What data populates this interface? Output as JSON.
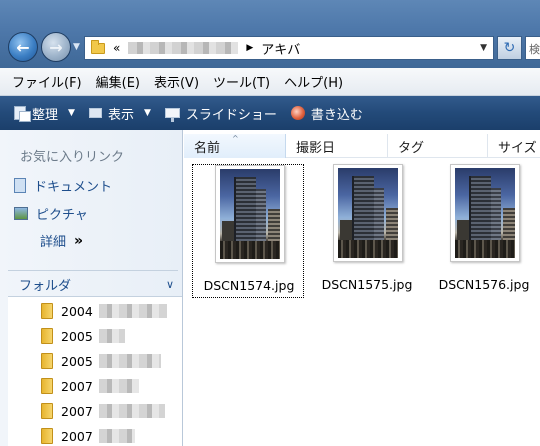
{
  "window": {
    "address": {
      "prefix": "«",
      "current_folder": "アキバ"
    },
    "search_placeholder": "検"
  },
  "menu": [
    {
      "label": "ファイル(F)"
    },
    {
      "label": "編集(E)"
    },
    {
      "label": "表示(V)"
    },
    {
      "label": "ツール(T)"
    },
    {
      "label": "ヘルプ(H)"
    }
  ],
  "toolbar": {
    "organize": "整理",
    "views": "表示",
    "slideshow": "スライドショー",
    "burn": "書き込む"
  },
  "navpane": {
    "favorites_header": "お気に入りリンク",
    "favorites": [
      {
        "label": "ドキュメント"
      },
      {
        "label": "ピクチャ"
      }
    ],
    "more_label": "詳細",
    "more_chevron": "»",
    "folders_header": "フォルダ",
    "folders": [
      {
        "label": "2004"
      },
      {
        "label": "2005"
      },
      {
        "label": "2005"
      },
      {
        "label": "2007"
      },
      {
        "label": "2007"
      },
      {
        "label": "2007"
      }
    ]
  },
  "columns": {
    "name": "名前",
    "date": "撮影日",
    "tags": "タグ",
    "size": "サイズ"
  },
  "files": [
    {
      "name": "DSCN1574.jpg"
    },
    {
      "name": "DSCN1575.jpg"
    },
    {
      "name": "DSCN1576.jpg"
    }
  ],
  "icons": [
    "back-arrow-icon",
    "forward-arrow-icon",
    "folder-icon",
    "refresh-icon",
    "organize-icon",
    "views-icon",
    "slideshow-icon",
    "burn-icon",
    "documents-icon",
    "pictures-icon",
    "chevron-down-icon"
  ]
}
